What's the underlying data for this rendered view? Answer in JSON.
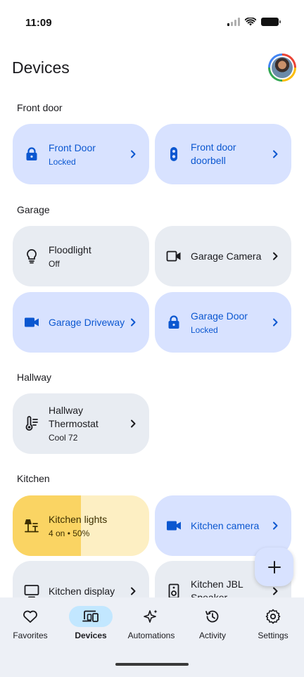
{
  "status_bar": {
    "time": "11:09"
  },
  "header": {
    "title": "Devices"
  },
  "sections": [
    {
      "title": "Front door"
    },
    {
      "title": "Garage"
    },
    {
      "title": "Hallway"
    },
    {
      "title": "Kitchen"
    }
  ],
  "devices": [
    {
      "name": "Front Door",
      "status": "Locked",
      "icon": "lock-icon",
      "style": "blue"
    },
    {
      "name": "Front door doorbell",
      "status": "",
      "icon": "doorbell-icon",
      "style": "blue"
    },
    {
      "name": "Floodlight",
      "status": "Off",
      "icon": "lightbulb-icon",
      "style": "gray"
    },
    {
      "name": "Garage Camera",
      "status": "",
      "icon": "camera-icon",
      "style": "gray"
    },
    {
      "name": "Garage Driveway",
      "status": "",
      "icon": "camera-icon",
      "style": "blue"
    },
    {
      "name": "Garage Door",
      "status": "Locked",
      "icon": "lock-icon",
      "style": "blue"
    },
    {
      "name": "Hallway Thermostat",
      "status": "Cool 72",
      "icon": "thermostat-icon",
      "style": "gray"
    },
    {
      "name": "Kitchen lights",
      "status": "4 on • 50%",
      "icon": "lamp-icon",
      "style": "yellow",
      "brightness": 0.5
    },
    {
      "name": "Kitchen camera",
      "status": "",
      "icon": "camera-icon",
      "style": "blue"
    },
    {
      "name": "Kitchen display",
      "status": "",
      "icon": "display-icon",
      "style": "gray"
    },
    {
      "name": "Kitchen JBL Speaker",
      "status": "",
      "icon": "speaker-icon",
      "style": "gray"
    }
  ],
  "fab": {
    "icon": "plus-icon"
  },
  "nav": [
    {
      "label": "Favorites",
      "icon": "heart-icon",
      "active": false
    },
    {
      "label": "Devices",
      "icon": "devices-icon",
      "active": true
    },
    {
      "label": "Automations",
      "icon": "sparkle-icon",
      "active": false
    },
    {
      "label": "Activity",
      "icon": "history-icon",
      "active": false
    },
    {
      "label": "Settings",
      "icon": "gear-icon",
      "active": false
    }
  ],
  "colors": {
    "blue_tile": "#d8e2ff",
    "blue_text": "#0b57d0",
    "gray_tile": "#e8ecf2",
    "yellow_tile": "#fdefc3",
    "yellow_fill": "#fad463",
    "nav_active": "#c2e7ff"
  }
}
